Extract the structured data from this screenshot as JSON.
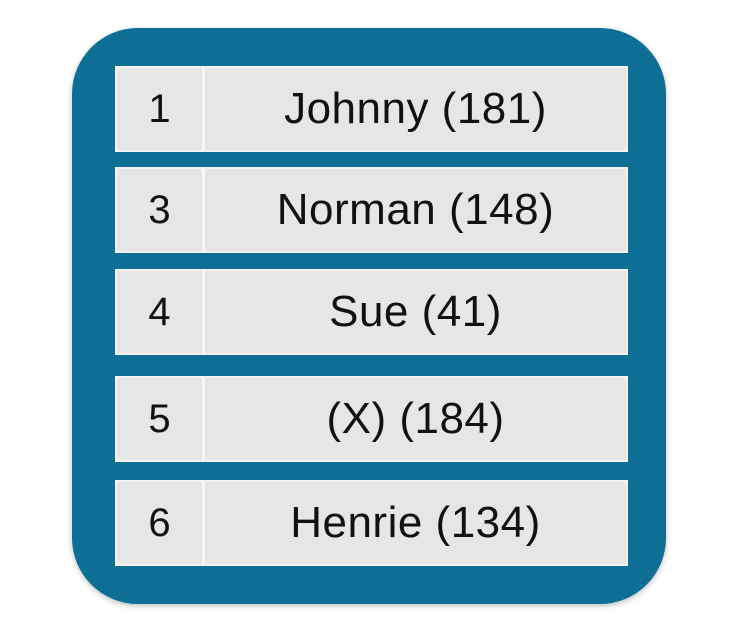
{
  "colors": {
    "panel": "#0d6f96",
    "row_background": "#e6e6e6",
    "text": "#111111"
  },
  "rows": [
    {
      "index": "1",
      "label": "Johnny (181)"
    },
    {
      "index": "3",
      "label": "Norman (148)"
    },
    {
      "index": "4",
      "label": "Sue (41)"
    },
    {
      "index": "5",
      "label": "(X) (184)"
    },
    {
      "index": "6",
      "label": "Henrie (134)"
    }
  ]
}
